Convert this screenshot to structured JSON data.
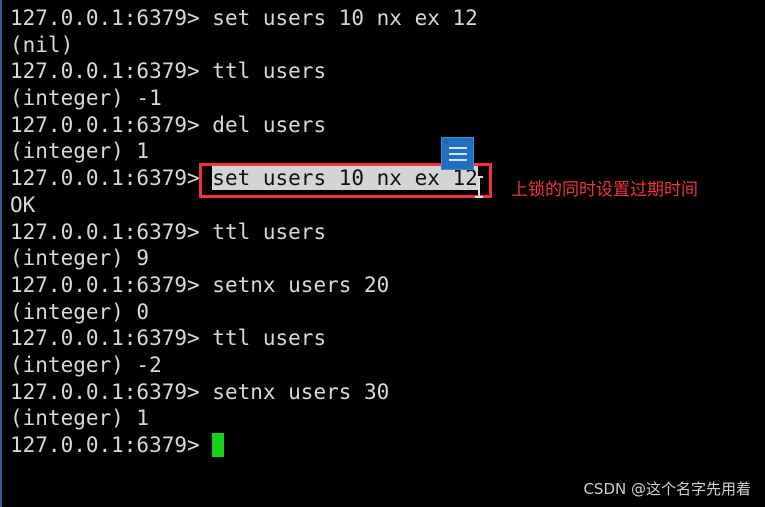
{
  "terminal": {
    "prompt": "127.0.0.1:6379> ",
    "lines": [
      {
        "type": "cmd",
        "text": "set users 10 nx ex 12"
      },
      {
        "type": "out",
        "text": "(nil)"
      },
      {
        "type": "cmd",
        "text": "ttl users"
      },
      {
        "type": "out",
        "text": "(integer) -1"
      },
      {
        "type": "cmd",
        "text": "del users"
      },
      {
        "type": "out",
        "text": "(integer) 1"
      },
      {
        "type": "cmd",
        "text": "set users 10 nx ex 12",
        "selected": true
      },
      {
        "type": "out",
        "text": "OK"
      },
      {
        "type": "cmd",
        "text": "ttl users"
      },
      {
        "type": "out",
        "text": "(integer) 9"
      },
      {
        "type": "cmd",
        "text": "setnx users 20"
      },
      {
        "type": "out",
        "text": "(integer) 0"
      },
      {
        "type": "cmd",
        "text": "ttl users"
      },
      {
        "type": "out",
        "text": "(integer) -2"
      },
      {
        "type": "cmd",
        "text": "setnx users 30"
      },
      {
        "type": "out",
        "text": "(integer) 1"
      },
      {
        "type": "cmd",
        "text": "",
        "cursor": true
      }
    ],
    "cursor_color": "#19d119"
  },
  "annotation": {
    "text": "上锁的同时设置过期时间",
    "color": "#f0353a"
  },
  "watermark": "CSDN @这个名字先用着",
  "icons": {
    "menu": "menu-lines-icon",
    "cursor": "text-ibeam-icon"
  }
}
